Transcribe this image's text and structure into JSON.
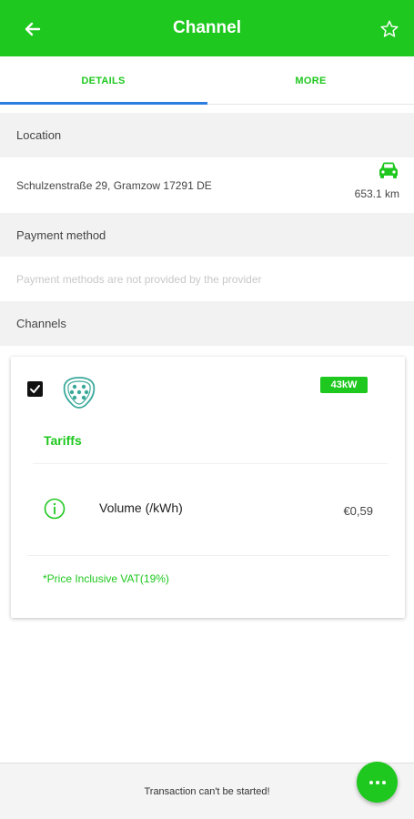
{
  "appbar": {
    "title": "Channel",
    "back_icon": "arrow-left-icon",
    "favorite_icon": "star-outline-icon"
  },
  "tabs": [
    {
      "label": "DETAILS",
      "active": true
    },
    {
      "label": "MORE",
      "active": false
    }
  ],
  "location": {
    "header": "Location",
    "address": "Schulzenstraße 29, Gramzow 17291 DE",
    "distance": "653.1 km",
    "icon": "car-icon"
  },
  "payment": {
    "header": "Payment method",
    "message": "Payment methods are not provided by the provider"
  },
  "channels": {
    "header": "Channels",
    "card": {
      "checked": true,
      "connector_icon": "type2-connector-icon",
      "power_badge": "43kW",
      "tariffs_title": "Tariffs",
      "tariff": {
        "name": "Volume (/kWh)",
        "price": "€0,59",
        "icon": "info-icon"
      },
      "vat_note": "*Price Inclusive VAT(19%)"
    }
  },
  "footer": {
    "status": "Transaction can't be started!",
    "fab_icon": "more-horizontal-icon"
  },
  "colors": {
    "primary": "#1ec81e",
    "tab_indicator": "#2d7de0",
    "section_bg": "#f2f2f2"
  }
}
